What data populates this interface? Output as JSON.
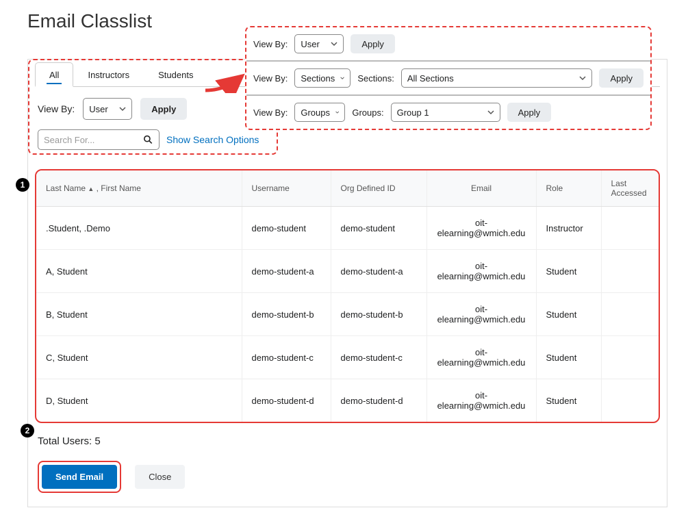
{
  "page": {
    "title": "Email Classlist"
  },
  "callout": {
    "viewby_label": "View By:",
    "sections_label": "Sections:",
    "groups_label": "Groups:",
    "apply_label": "Apply",
    "row1_select": "User",
    "row2_select": "Sections",
    "row2_sections": "All Sections",
    "row3_select": "Groups",
    "row3_group": "Group 1"
  },
  "tabs": {
    "all": "All",
    "instructors": "Instructors",
    "students": "Students"
  },
  "filter": {
    "viewby_label": "View By:",
    "select_value": "User",
    "apply_label": "Apply",
    "search_placeholder": "Search For...",
    "search_options": "Show Search Options"
  },
  "table": {
    "headers": {
      "name": "Last Name",
      "name_suffix": " , First Name",
      "username": "Username",
      "orgid": "Org Defined ID",
      "email": "Email",
      "role": "Role",
      "last_accessed": "Last Accessed"
    },
    "rows": [
      {
        "name": ".Student, .Demo",
        "username": "demo-student",
        "orgid": "demo-student",
        "email": "oit-elearning@wmich.edu",
        "role": "Instructor",
        "last": ""
      },
      {
        "name": "A, Student",
        "username": "demo-student-a",
        "orgid": "demo-student-a",
        "email": "oit-elearning@wmich.edu",
        "role": "Student",
        "last": ""
      },
      {
        "name": "B, Student",
        "username": "demo-student-b",
        "orgid": "demo-student-b",
        "email": "oit-elearning@wmich.edu",
        "role": "Student",
        "last": ""
      },
      {
        "name": "C, Student",
        "username": "demo-student-c",
        "orgid": "demo-student-c",
        "email": "oit-elearning@wmich.edu",
        "role": "Student",
        "last": ""
      },
      {
        "name": "D, Student",
        "username": "demo-student-d",
        "orgid": "demo-student-d",
        "email": "oit-elearning@wmich.edu",
        "role": "Student",
        "last": ""
      }
    ]
  },
  "footer": {
    "total_users": "Total Users: 5",
    "send_email": "Send Email",
    "close": "Close"
  },
  "badges": {
    "one": "1",
    "two": "2"
  }
}
